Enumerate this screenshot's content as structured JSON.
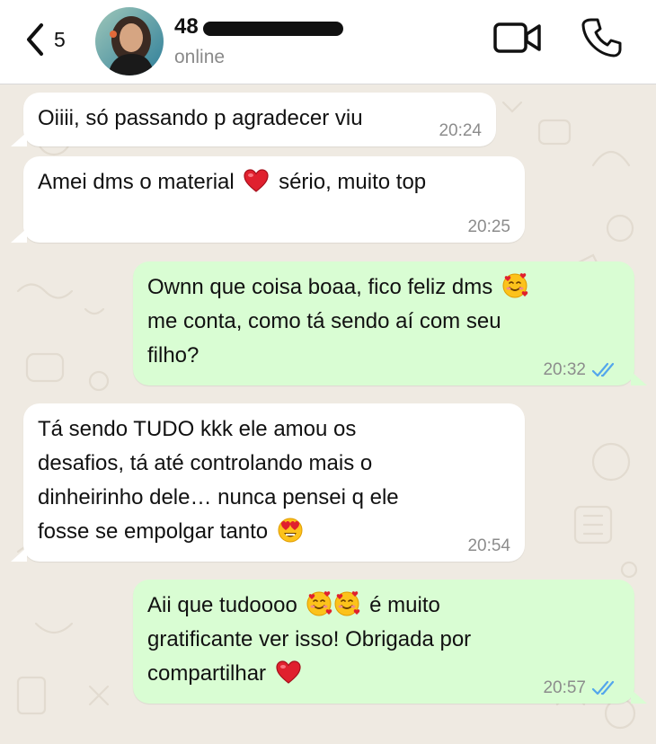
{
  "header": {
    "back_count": "5",
    "contact_name": "48",
    "status": "online"
  },
  "messages": [
    {
      "direction": "in",
      "lines": [
        "Oiiii, só passando p agradecer viu"
      ],
      "time": "20:24"
    },
    {
      "direction": "in",
      "lines": [
        "Amei dms o material",
        "sério, muito top"
      ],
      "time": "20:25"
    },
    {
      "direction": "out",
      "lines": [
        "Ownn que coisa boaa, fico feliz dms",
        "me conta, como tá sendo aí com seu",
        "filho?"
      ],
      "time": "20:32"
    },
    {
      "direction": "in",
      "lines": [
        "Tá sendo TUDO kkk ele amou os",
        "desafios, tá até controlando mais o",
        "dinheirinho dele… nunca pensei q ele",
        "fosse se empolgar tanto"
      ],
      "time": "20:54"
    },
    {
      "direction": "out",
      "lines": [
        "Aii que tudoooo",
        "é muito",
        "gratificante ver isso! Obrigada por",
        "compartilhar"
      ],
      "time": "20:57"
    }
  ],
  "icons": {
    "back": "chevron-left-icon",
    "video": "video-camera-icon",
    "call": "phone-icon",
    "read_receipt": "double-check-icon",
    "heart": "red-heart-emoji",
    "smiling_hearts": "smiling-face-with-hearts-emoji",
    "heart_eyes": "heart-eyes-emoji"
  },
  "colors": {
    "chat_background": "#efeae2",
    "incoming_bubble": "#ffffff",
    "outgoing_bubble": "#d9fdd3",
    "read_tick": "#53a6ec",
    "heart": "#e0202e"
  }
}
